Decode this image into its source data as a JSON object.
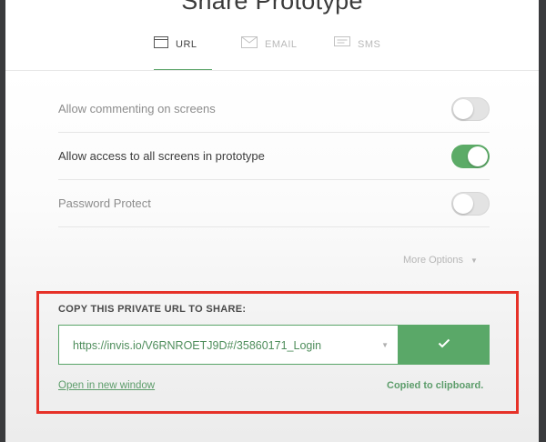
{
  "modal": {
    "title": "Share Prototype",
    "tabs": [
      {
        "label": "URL",
        "icon": "browser-window-icon",
        "active": true
      },
      {
        "label": "EMAIL",
        "icon": "envelope-icon",
        "active": false
      },
      {
        "label": "SMS",
        "icon": "chat-bubble-icon",
        "active": false
      }
    ],
    "settings": [
      {
        "label": "Allow commenting on screens",
        "enabled": false
      },
      {
        "label": "Allow access to all screens in prototype",
        "enabled": true
      },
      {
        "label": "Password Protect",
        "enabled": false
      }
    ],
    "more_options": "More Options",
    "copy_section": {
      "heading": "COPY THIS PRIVATE URL TO SHARE:",
      "url": "https://invis.io/V6RNROETJ9D#/35860171_Login",
      "copy_button_icon": "checkmark-icon",
      "open_link": "Open in new window",
      "status": "Copied to clipboard."
    },
    "colors": {
      "accent": "#5aa868",
      "highlight": "#e63128"
    }
  }
}
